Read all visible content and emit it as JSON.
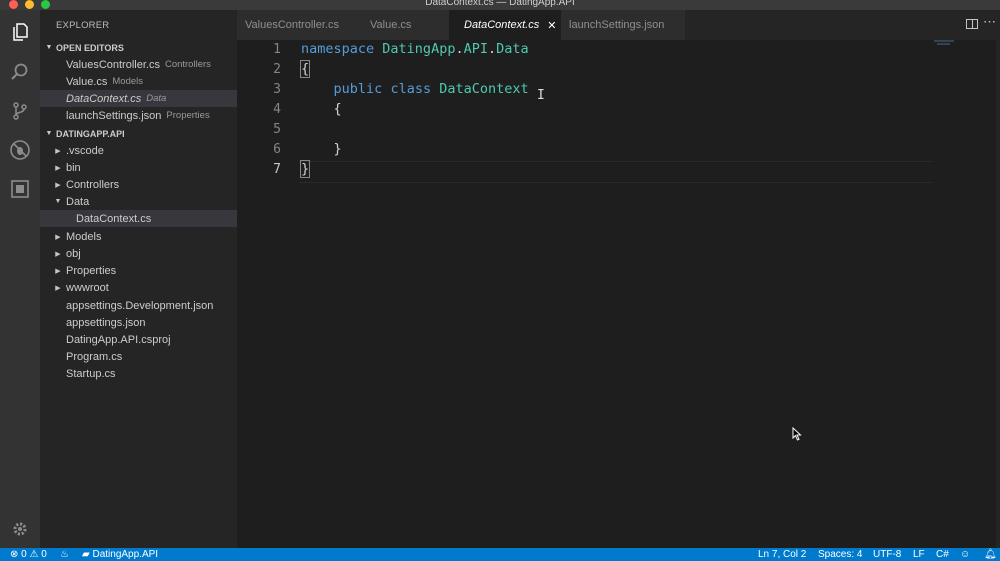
{
  "window": {
    "title": "DataContext.cs — DatingApp.API"
  },
  "colors": {
    "close": "#ff5f57",
    "minimize": "#febc2e",
    "maximize": "#28c840",
    "status_bar": "#007acc",
    "keyword": "#569cd6",
    "type": "#4ec9b0"
  },
  "activity_bar": {
    "icons": [
      "files-icon",
      "search-icon",
      "source-control-icon",
      "debug-icon",
      "extensions-icon",
      "gear-icon"
    ]
  },
  "explorer": {
    "header": "EXPLORER",
    "open_editors": {
      "label": "OPEN EDITORS",
      "items": [
        {
          "name": "ValuesController.cs",
          "desc": "Controllers"
        },
        {
          "name": "Value.cs",
          "desc": "Models"
        },
        {
          "name": "DataContext.cs",
          "desc": "Data"
        },
        {
          "name": "launchSettings.json",
          "desc": "Properties"
        }
      ]
    },
    "project": {
      "label": "DATINGAPP.API",
      "items": [
        {
          "name": ".vscode"
        },
        {
          "name": "bin"
        },
        {
          "name": "Controllers"
        },
        {
          "name": "Data"
        },
        {
          "name": "DataContext.cs"
        },
        {
          "name": "Models"
        },
        {
          "name": "obj"
        },
        {
          "name": "Properties"
        },
        {
          "name": "wwwroot"
        },
        {
          "name": "appsettings.Development.json"
        },
        {
          "name": "appsettings.json"
        },
        {
          "name": "DatingApp.API.csproj"
        },
        {
          "name": "Program.cs"
        },
        {
          "name": "Startup.cs"
        }
      ]
    }
  },
  "tabs": [
    {
      "label": "ValuesController.cs"
    },
    {
      "label": "Value.cs"
    },
    {
      "label": "DataContext.cs",
      "close": "✕"
    },
    {
      "label": "launchSettings.json"
    }
  ],
  "editor": {
    "line_numbers": [
      "1",
      "2",
      "3",
      "4",
      "5",
      "6",
      "7"
    ],
    "line1": {
      "kw": "namespace",
      "ns1": "DatingApp",
      "dot1": ".",
      "ns2": "API",
      "dot2": ".",
      "ns3": "Data"
    },
    "line2": "{",
    "line3": {
      "kw1": "public",
      "kw2": "class",
      "name": "DataContext"
    },
    "line4": "{",
    "line6": "}",
    "line7": "}"
  },
  "status": {
    "errors": "0",
    "warnings": "0",
    "folder": "DatingApp.API",
    "position": "Ln 7, Col 2",
    "spaces": "Spaces: 4",
    "encoding": "UTF-8",
    "eol": "LF",
    "language": "C#"
  }
}
